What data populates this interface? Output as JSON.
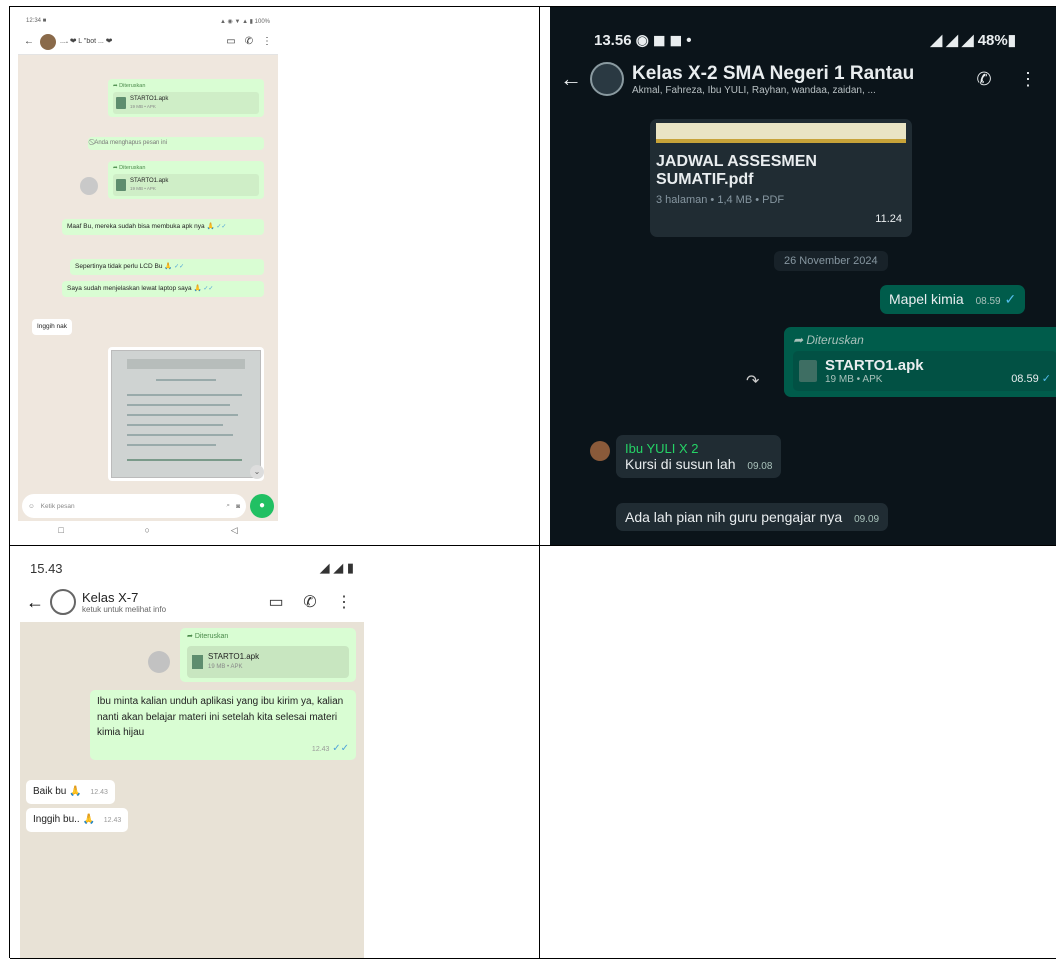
{
  "panel1": {
    "status_left": "12:34 ■",
    "status_right": "▲ ◉ ▼ ▲ ▮ 100%",
    "chat_name": "...𝆺 ❤ L \"bot ... ❤",
    "fwd_label": "Diteruskan",
    "file_name": "STARTO1.apk",
    "file_meta": "19 MB • APK",
    "deleted_note": "Anda menghapus pesan ini",
    "msg1": "Maaf Bu, mereka sudah bisa membuka apk nya 🙏",
    "msg2": "Sepertinya tidak perlu LCD Bu 🙏",
    "msg3": "Saya sudah menjelaskan lewat laptop saya 🙏",
    "msg_in": "Inggih nak",
    "input_placeholder": "Ketik pesan",
    "check": "✓✓"
  },
  "panel2": {
    "status_left": "13.56 ◉ ◼ ◼ •",
    "status_right": "◢ ◢ ◢ 48%▮",
    "chat_name": "Kelas X-2 SMA Negeri 1 Rantau",
    "members": "Akmal, Fahreza, Ibu YULI, Rayhan, wandaa, zaidan, ...",
    "pdf_title": "JADWAL ASSESMEN SUMATIF.pdf",
    "pdf_meta": "3 halaman • 1,4 MB • PDF",
    "pdf_time": "11.24",
    "date_chip": "26 November 2024",
    "msg_out": "Mapel kimia",
    "msg_out_time": "08.59",
    "fwd_label": "Diteruskan",
    "file_name": "STARTO1.apk",
    "file_meta": "19 MB • APK",
    "file_time": "08.59",
    "sender": "Ibu YULI X 2",
    "msg_in1": "Kursi di susun lah",
    "msg_in1_time": "09.08",
    "msg_in2": "Ada lah pian nih guru pengajar nya",
    "msg_in2_time": "09.09",
    "check": "✓"
  },
  "panel3": {
    "status_left": "15.43",
    "status_right": "◢ ◢ ▮",
    "chat_name": "Kelas X-7",
    "subtitle": "ketuk untuk melihat info",
    "fwd_label": "Diteruskan",
    "file_name": "STARTO1.apk",
    "file_meta": "19 MB • APK",
    "msg_out": "Ibu minta kalian unduh aplikasi yang ibu kirim ya, kalian nanti akan belajar materi ini setelah kita selesai materi kimia hijau",
    "msg_out_time": "12.43",
    "msg_in1": "Baik bu 🙏",
    "msg_in1_time": "12.43",
    "msg_in2": "Inggih bu.. 🙏",
    "msg_in2_time": "12.43",
    "check": "✓✓"
  }
}
